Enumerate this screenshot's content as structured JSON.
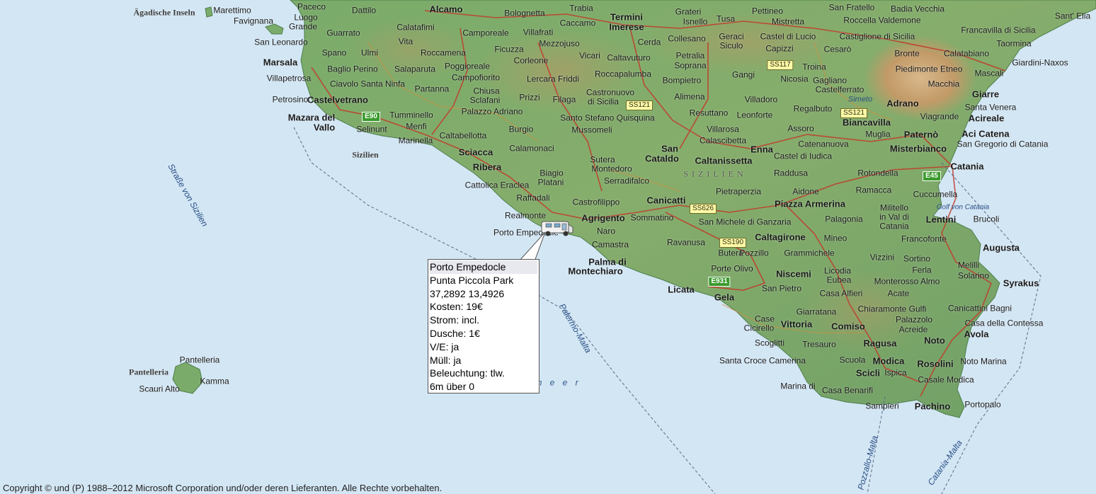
{
  "colors": {
    "sea": "#d3e6f4",
    "land_low": "#6fa56b",
    "land_high": "#c9a671",
    "roads": "#c23a2a"
  },
  "cities": [
    "Alcamo",
    "Marsala",
    "Castelvetrano",
    "Mazara del",
    "Vallo",
    "Sciacca",
    "Ribera",
    "Termini",
    "Imerese",
    "Agrigento",
    "Canicatti",
    "San",
    "Cataldo",
    "Caltanissetta",
    "Enna",
    "Piazza Armerina",
    "Caltagirone",
    "Palma di",
    "Montechiaro",
    "Licata",
    "Gela",
    "Niscemi",
    "Vittoria",
    "Comiso",
    "Ragusa",
    "Modica",
    "Scicli",
    "Pachino",
    "Rosolini",
    "Noto",
    "Avola",
    "Syrakus",
    "Augusta",
    "Lentini",
    "Catania",
    "Acireale",
    "Aci Catena",
    "Misterbianco",
    "Paternò",
    "Adrano",
    "Biancavilla",
    "Giarre"
  ],
  "towns": [
    "Paceco",
    "Luogo",
    "Grande",
    "Dattilo",
    "Bolognetta",
    "Trabia",
    "Grateri",
    "Isnello",
    "Tusa",
    "Pettineo",
    "Mistretta",
    "San Fratello",
    "Badia Vecchia",
    "Roccella Valdemone",
    "Sant' Elia",
    "Guarrato",
    "Calatafimi",
    "Camporeale",
    "Villafrati",
    "Caccamo",
    "Collesano",
    "Geraci",
    "Siculo",
    "Castel di Lucio",
    "Castiglione di Sicilia",
    "Francavilla di Sicilia",
    "Favignana",
    "Marettimo",
    "San Leonardo",
    "Spano",
    "Ulmi",
    "Vita",
    "Roccamena",
    "Ficuzza",
    "Mezzojuso",
    "Cerda",
    "Capizzi",
    "Cesarò",
    "Taormina",
    "Villapetrosa",
    "Baglio Perino",
    "Salaparuta",
    "Poggioreale",
    "Campofiorito",
    "Corleone",
    "Vicari",
    "Caltavuturo",
    "Petralia",
    "Soprana",
    "Troina",
    "Bronte",
    "Calatabiano",
    "Ciavolo Santa Ninfa",
    "Partanna",
    "Chiusa",
    "Sclafani",
    "Lercara Friddi",
    "Roccapalumba",
    "Bompietro",
    "Gangi",
    "Nicosia",
    "Gagliano",
    "Castelferrato",
    "Piedimonte Etneo",
    "Mascali",
    "Giardini-Naxos",
    "Petrosino",
    "Prizzi",
    "Filaga",
    "Castronuovo",
    "di Sicilia",
    "Alimena",
    "Villadoro",
    "Macchia",
    "Tumminello",
    "Menfi",
    "Palazzo Adriano",
    "Santo Stefano Quisquina",
    "Resuttano",
    "Leonforte",
    "Regalbuto",
    "Santa Venera",
    "Selinunt",
    "Caltabellotta",
    "Burgio",
    "Mussomeli",
    "Villarosa",
    "Assoro",
    "Viagrande",
    "Marinella",
    "Calamonaci",
    "Sutera",
    "Calascibetta",
    "Catenanuova",
    "Muglia",
    "San Gregorio di Catania",
    "Biagio",
    "Platani",
    "Montedoro",
    "Castel di Iudica",
    "Serradifalco",
    "Raddusa",
    "Rotondella",
    "Cattolica Eraclea",
    "Raffadali",
    "Pietraperzia",
    "Aidone",
    "Ramacca",
    "Cuccumella",
    "Castrofilippo",
    "Militello",
    "in Val di",
    "Catania",
    "Realmonte",
    "Porto Empedocle",
    "Sommatino",
    "San Michele di Ganzaria",
    "Palagonia",
    "Brucoli",
    "Naro",
    "Camastra",
    "Ravanusa",
    "Mineo",
    "Francofonte",
    "Butera",
    "Pozzillo",
    "Grammichele",
    "Vizzini",
    "Sortino",
    "Melilli",
    "Solarino",
    "Porte Olivo",
    "Licodia",
    "Eubea",
    "Ferla",
    "San Pietro",
    "Casa Alfieri",
    "Monterosso Almo",
    "Giarratana",
    "Acate",
    "Chiaramonte Gulfi",
    "Canicattini Bagni",
    "Case",
    "Cicirello",
    "Palazzolo",
    "Acreide",
    "Scoglitti",
    "Tresauro",
    "Santa Croce Camerina",
    "Scuola",
    "Marina di",
    "Casa Benarifi",
    "Ispica",
    "Casale Modica",
    "Noto Marina",
    "Casa della Contessa",
    "Sampieri",
    "Portopalo",
    "Scauri Alto",
    "Kamma",
    "Pantelleria"
  ],
  "islands": [
    "Ägadische Inseln",
    "Pantelleria",
    "Sizilien"
  ],
  "region_label": "SIZILIEN",
  "sea_labels": [
    "Straße von Sizilien",
    "Palermo-Malta",
    "Pozzallo-Malta",
    "Catania-Malta",
    "Golf von Catania",
    "Simeto",
    "m e e r"
  ],
  "road_shields": [
    "SS117",
    "SS121",
    "SS121",
    "SS626",
    "SS190"
  ],
  "euro_routes": [
    "E90",
    "E45",
    "E931"
  ],
  "marker_icon": "camper-van-icon",
  "popup": {
    "lines": [
      "Porto Empedocle",
      "Punta Piccola Park",
      "37,2892 13,4926",
      "Kosten: 19€",
      "Strom: incl.",
      "Dusche: 1€",
      "V/E: ja",
      "Müll: ja",
      "Beleuchtung: tlw.",
      "6m über 0"
    ]
  },
  "footer": {
    "copyright": "Copyright © und (P) 1988–2012 Microsoft Corporation und/oder deren Lieferanten. Alle Rechte vorbehalten."
  }
}
